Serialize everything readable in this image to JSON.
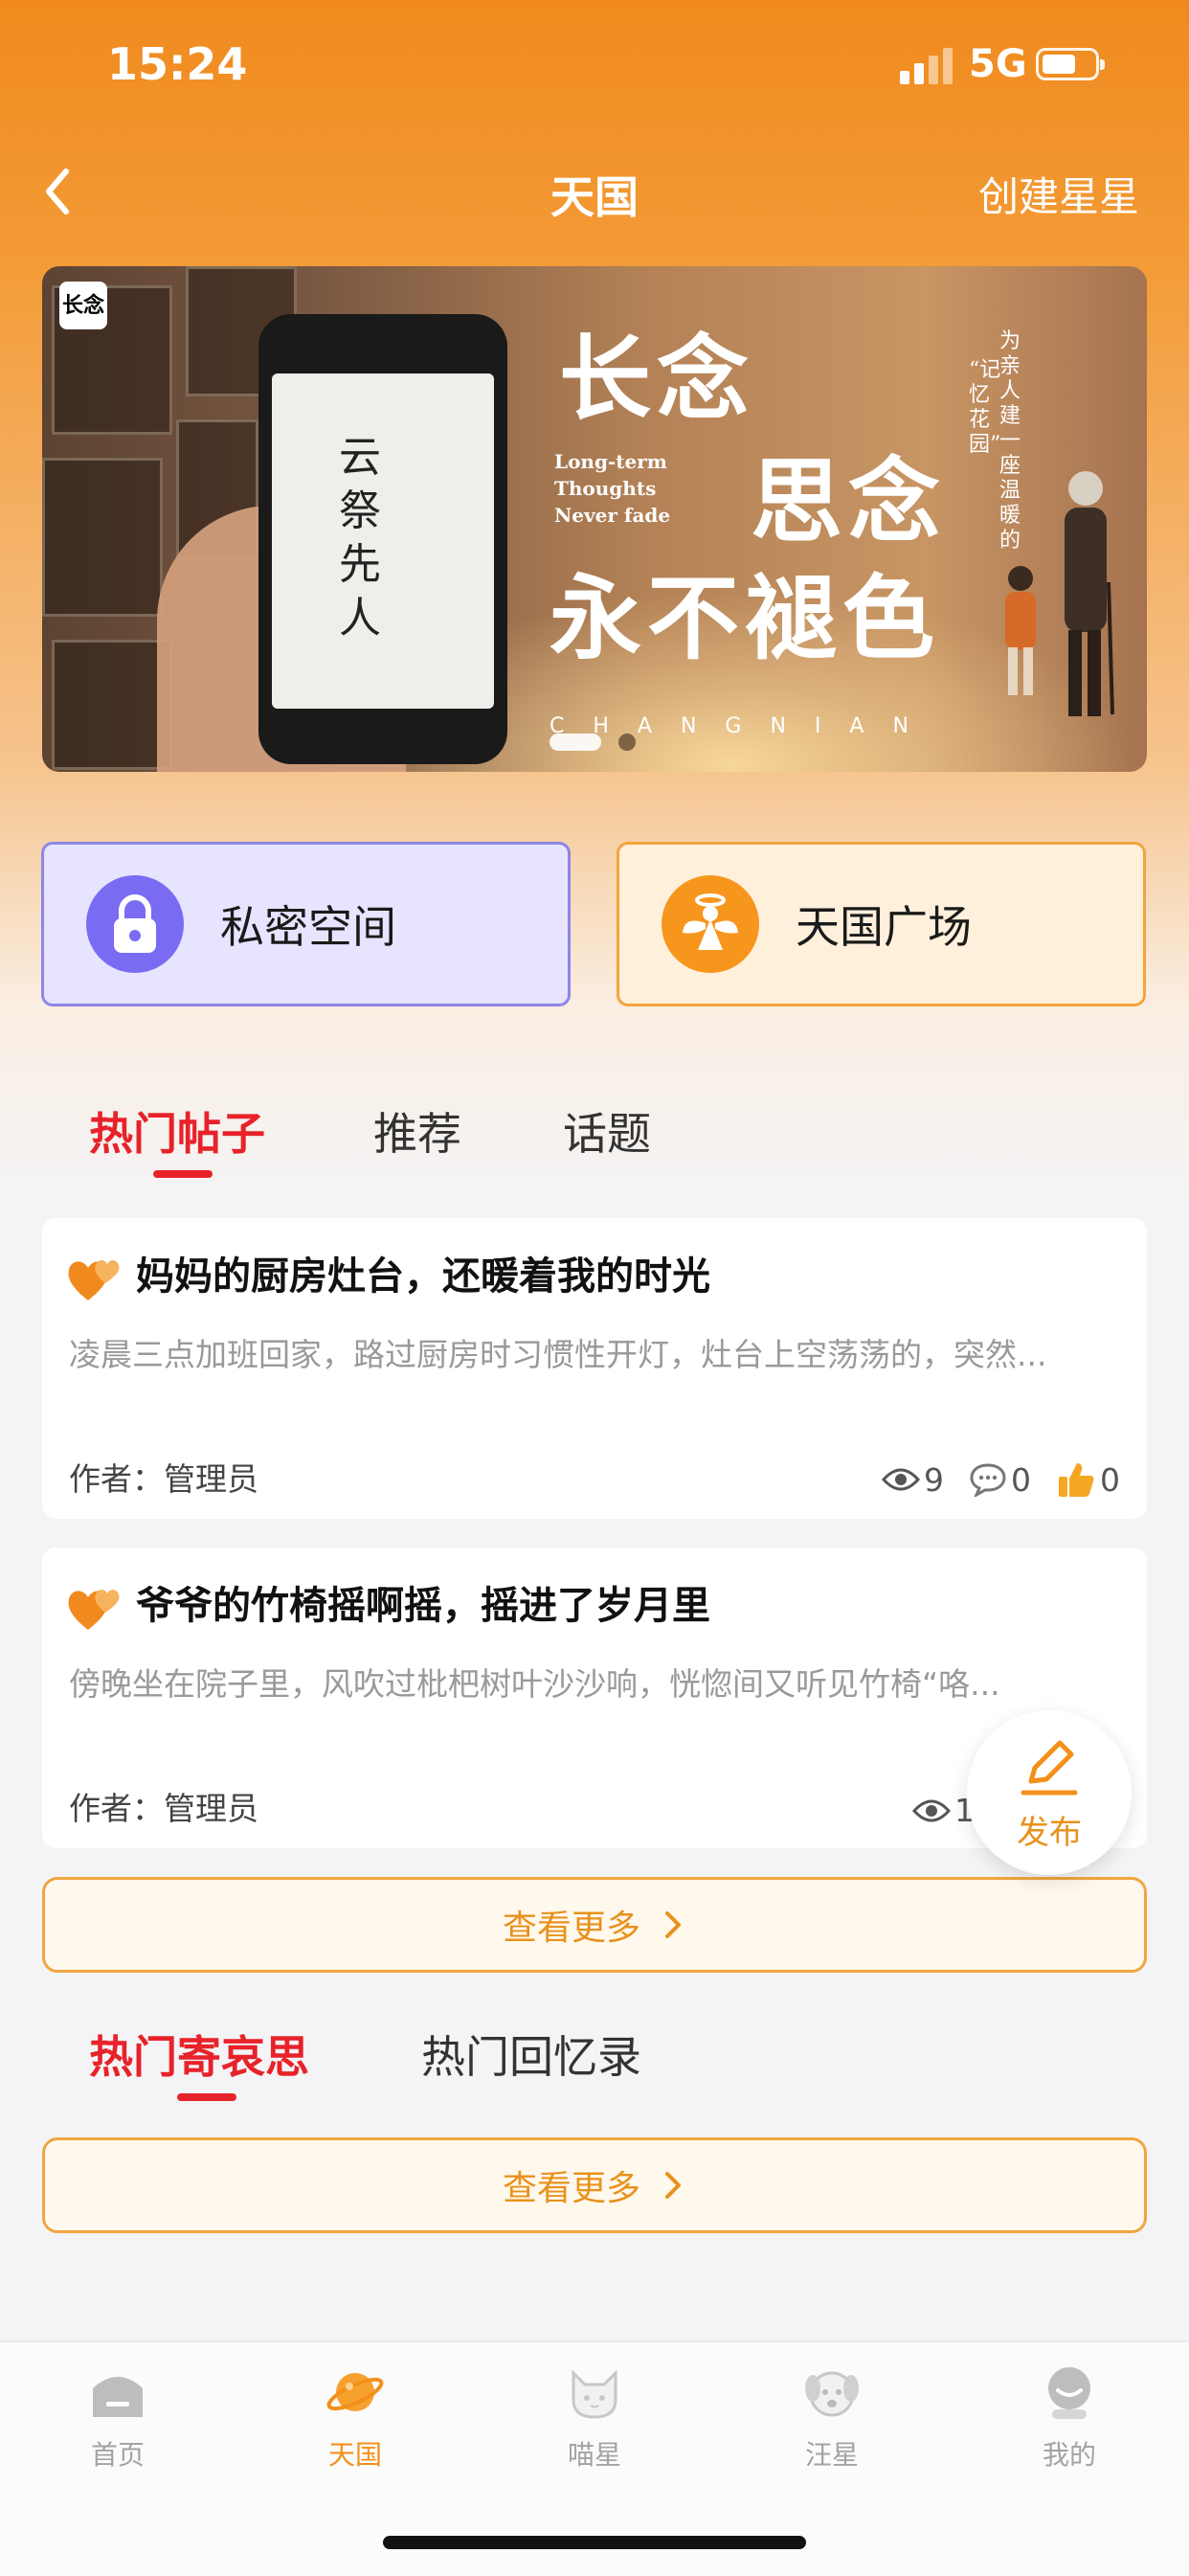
{
  "status_bar": {
    "time": "15:24",
    "network": "5G"
  },
  "nav": {
    "title": "天国",
    "action": "创建星星"
  },
  "banner": {
    "logo": "长念",
    "phone_text": "云祭先人",
    "line1": "长念",
    "line2": "思念",
    "line3": "永不褪色",
    "english": [
      "Long-term",
      "Thoughts",
      "Never fade"
    ],
    "side_text_1": "为亲人建一座温暖的",
    "side_text_2": "“记忆花园”",
    "spaced": "CHANGNIAN"
  },
  "quick": {
    "private": "私密空间",
    "plaza": "天国广场"
  },
  "tabs1": [
    "热门帖子",
    "推荐",
    "话题"
  ],
  "posts": [
    {
      "title": "妈妈的厨房灶台，还暖着我的时光",
      "excerpt": "凌晨三点加班回家，路过厨房时习惯性开灯，灶台上空荡荡的，突然...",
      "author": "作者：管理员",
      "views": "9",
      "comments": "0",
      "likes": "0"
    },
    {
      "title": "爷爷的竹椅摇啊摇，摇进了岁月里",
      "excerpt": "傍晚坐在院子里，风吹过枇杷树叶沙沙响，恍惚间又听见竹椅“咯...",
      "author": "作者：管理员",
      "views": "1"
    }
  ],
  "more1": "查看更多",
  "tabs2": [
    "热门寄哀思",
    "热门回忆录"
  ],
  "more2": "查看更多",
  "fab": "发布",
  "tabbar": [
    "首页",
    "天国",
    "喵星",
    "汪星",
    "我的"
  ],
  "colors": {
    "accent": "#f39019",
    "active_tab": "#e8222a",
    "private_bg": "#e7e4ff",
    "plaza_bg": "#fff0dc"
  }
}
